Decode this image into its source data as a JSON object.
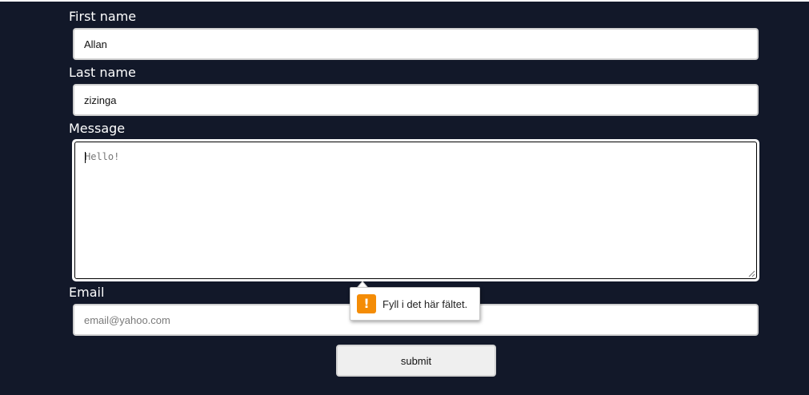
{
  "form": {
    "first_name": {
      "label": "First name",
      "value": "Allan"
    },
    "last_name": {
      "label": "Last name",
      "value": "zizinga"
    },
    "message": {
      "label": "Message",
      "value": "",
      "placeholder": "Hello!"
    },
    "email": {
      "label": "Email",
      "value": "",
      "placeholder": "email@yahoo.com"
    },
    "submit_label": "submit"
  },
  "validation_tooltip": {
    "text": "Fyll i det här fältet.",
    "icon": "warning-icon",
    "icon_glyph": "!"
  },
  "colors": {
    "background": "#121829",
    "field_border": "#d0d0d0",
    "warning": "#f48c06"
  }
}
